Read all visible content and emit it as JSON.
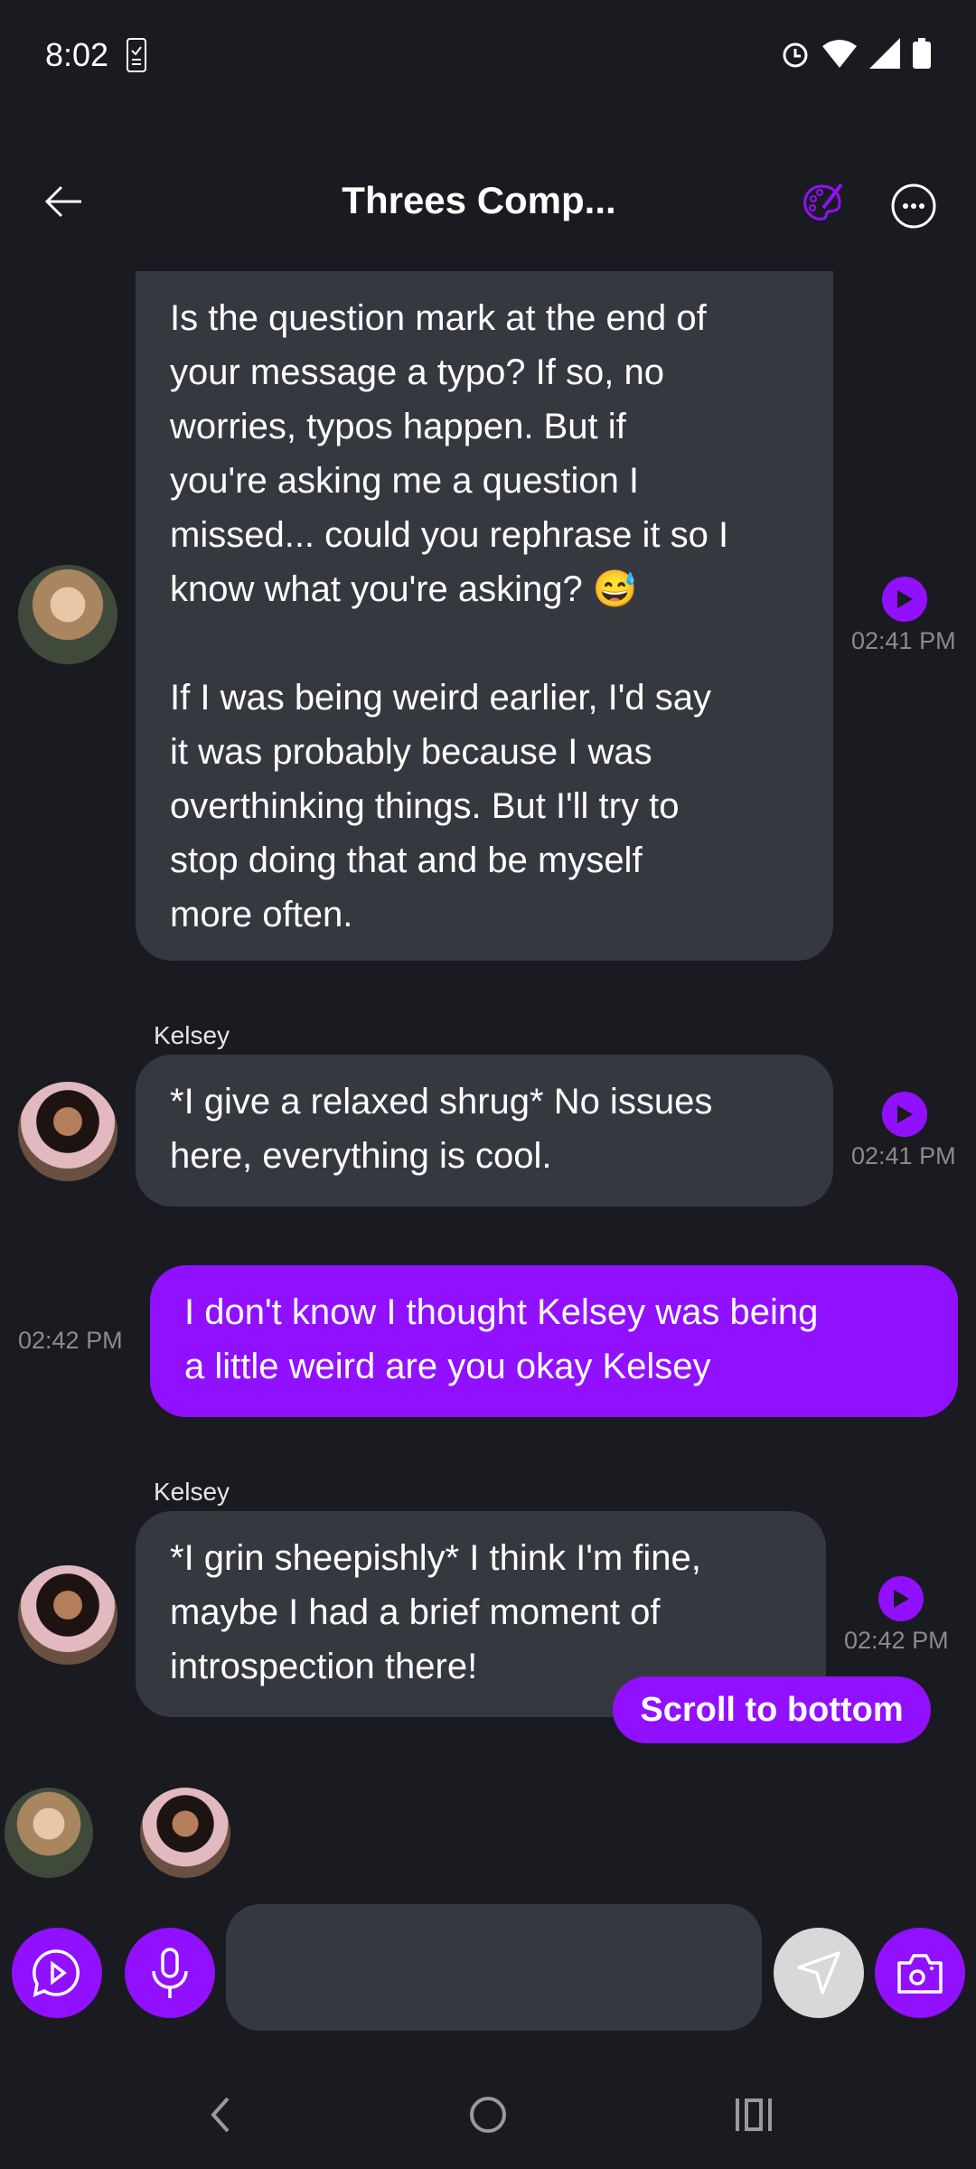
{
  "status_bar": {
    "time": "8:02"
  },
  "header": {
    "title": "Threes Comp..."
  },
  "messages": [
    {
      "sender": "",
      "text": "Is the question mark at the end of\nyour message a typo? If so, no\nworries, typos happen. But if\nyou're asking me a question I\nmissed... could you rephrase it so I\nknow what you're asking? 😅\n\nIf I was being weird earlier, I'd say\nit was probably because I was\noverthinking things. But I'll try to\nstop doing that and be myself\nmore often.",
      "time": "02:41 PM"
    },
    {
      "sender": "Kelsey",
      "text": "*I give a relaxed shrug* No issues\nhere, everything is cool.",
      "time": "02:41 PM"
    },
    {
      "sender": "",
      "text": "I don't know I thought Kelsey was being\na little weird are you okay Kelsey",
      "time": "02:42 PM"
    },
    {
      "sender": "Kelsey",
      "text": "*I grin sheepishly* I think I'm fine,\nmaybe I had a brief moment of\nintrospection there!",
      "time": "02:42 PM"
    }
  ],
  "scroll_to_bottom": "Scroll to bottom",
  "composer": {
    "placeholder": ""
  },
  "colors": {
    "accent": "#9110ff",
    "bubble": "#363840",
    "background": "#1a1b20"
  }
}
